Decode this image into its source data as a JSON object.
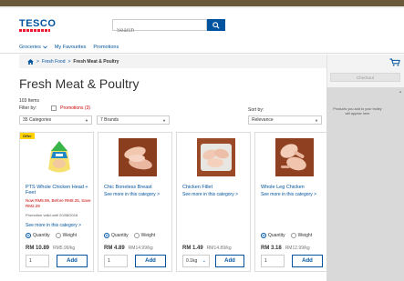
{
  "header": {
    "logo_text": "TESCO",
    "search_placeholder": "Search"
  },
  "nav": {
    "items": [
      {
        "label": "Groceries",
        "has_chevron": true
      },
      {
        "label": "My Favourites",
        "has_chevron": false
      },
      {
        "label": "Promotions",
        "has_chevron": false
      }
    ]
  },
  "breadcrumb": {
    "home_icon": "home-icon",
    "items": [
      "Fresh Food",
      "Fresh Meat & Poultry"
    ],
    "separator": ">"
  },
  "page": {
    "title": "Fresh Meat & Poultry",
    "items_count": "103 Items",
    "filter_label": "Filter by:",
    "promotions_filter": "Promotions (3)",
    "categories_select": "35 Categories",
    "brands_select": "7 Brands",
    "sort_label": "Sort by:",
    "sort_select": "Relevance"
  },
  "products": [
    {
      "name": "PTS Whole Chicken Head + Feet",
      "offer_badge": "Offer",
      "promo": "Now RM5.99, Before RM8.25, Save RM2.29",
      "promo_valid": "Promotion valid until 20/08/2018",
      "see_more": "See more in this category >",
      "quantity_label": "Quantity",
      "weight_label": "Weight",
      "price": "RM 10.89",
      "unit_price": "RM5.99/kg",
      "qty_value": "1",
      "add_label": "Add"
    },
    {
      "name": "Chic Boneless Breast",
      "see_more": "See more in this category >",
      "quantity_label": "Quantity",
      "weight_label": "Weight",
      "price": "RM 4.89",
      "unit_price": "RM14.99/kg",
      "qty_value": "1",
      "add_label": "Add"
    },
    {
      "name": "Chicken Fillet",
      "see_more": "See more in this category >",
      "price": "RM 1.49",
      "unit_price": "RM14.89/kg",
      "qty_value": "0.1kg",
      "add_label": "Add"
    },
    {
      "name": "Whole Leg Chicken",
      "see_more": "See more in this category >",
      "quantity_label": "Quantity",
      "weight_label": "Weight",
      "price": "RM 3.18",
      "unit_price": "RM12.99/kg",
      "qty_value": "1",
      "add_label": "Add"
    }
  ],
  "trolley": {
    "checkout_label": "Checkout",
    "empty_message": "Products you add to your trolley will appear here"
  },
  "colors": {
    "brand_blue": "#00539f",
    "brand_red": "#ee1c2e",
    "promo_red": "#cc0000",
    "offer_yellow": "#ffd200"
  }
}
